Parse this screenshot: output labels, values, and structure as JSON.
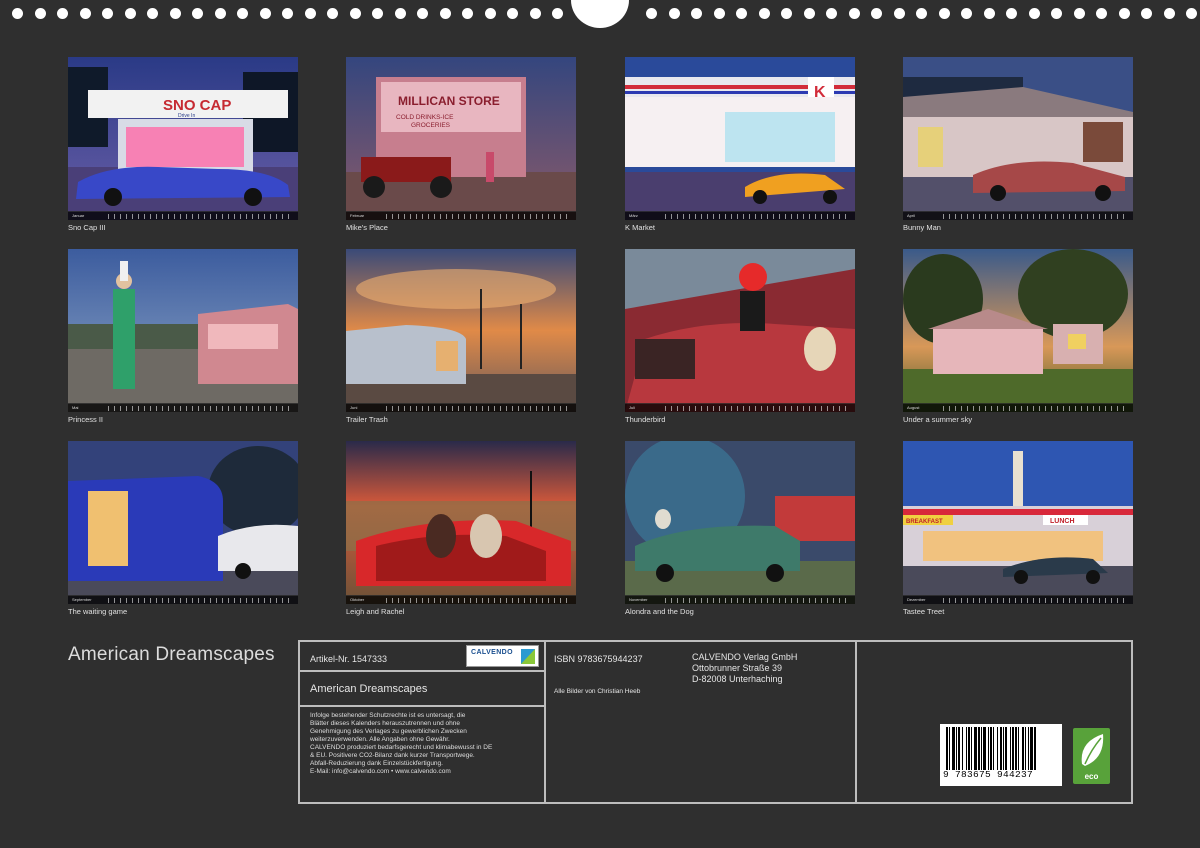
{
  "photos": [
    {
      "caption": "Sno Cap III",
      "month": "Januar"
    },
    {
      "caption": "Mike's Place",
      "month": "Februar"
    },
    {
      "caption": "K Market",
      "month": "März"
    },
    {
      "caption": "Bunny Man",
      "month": "April"
    },
    {
      "caption": "Princess II",
      "month": "Mai"
    },
    {
      "caption": "Trailer Trash",
      "month": "Juni"
    },
    {
      "caption": "Thunderbird",
      "month": "Juli"
    },
    {
      "caption": "Under a summer sky",
      "month": "August"
    },
    {
      "caption": "The waiting game",
      "month": "September"
    },
    {
      "caption": "Leigh and Rachel",
      "month": "Oktober"
    },
    {
      "caption": "Alondra and the Dog",
      "month": "November"
    },
    {
      "caption": "Tastee Treet",
      "month": "Dezember"
    }
  ],
  "sign_texts": {
    "sno_cap": "SNO CAP",
    "sno_cap_sub": "Drive In",
    "millican": "MILLICAN STORE",
    "millican_sub": "COLD DRINKS-ICE",
    "millican_sub2": "GROCERIES",
    "k": "K",
    "lunch": "LUNCH",
    "breakfast": "BREAKFAST"
  },
  "footer": {
    "title": "American Dreamscapes",
    "article_label": "Artikel-Nr. 1547333",
    "calvendo_word": "CALVENDO",
    "box_title": "American Dreamscapes",
    "legal_lines": [
      "Infolge bestehender Schutzrechte ist es untersagt, die",
      "Blätter dieses Kalenders herauszutrennen und ohne",
      "Genehmigung des Verlages zu gewerblichen Zwecken",
      "weiterzuverwenden. Alle Angaben ohne Gewähr.",
      "CALVENDO produziert bedarfsgerecht und klimabewusst in DE",
      "& EU. Positivere CO2-Bilanz dank kurzer Transportwege.",
      "Abfall-Reduzierung dank Einzelstückfertigung.",
      "E-Mail: info@calvendo.com • www.calvendo.com"
    ],
    "isbn": "ISBN 9783675944237",
    "photographer": "Alle Bilder von Christian Heeb",
    "publisher_lines": [
      "CALVENDO Verlag GmbH",
      "Ottobrunner Straße 39",
      "D-82008 Unterhaching"
    ],
    "barcode_number": "9 783675 944237",
    "eco_label": "eco"
  },
  "colors": {
    "background": "#2f2f2f",
    "frame": "#bdbdbd",
    "eco": "#58a23a"
  }
}
